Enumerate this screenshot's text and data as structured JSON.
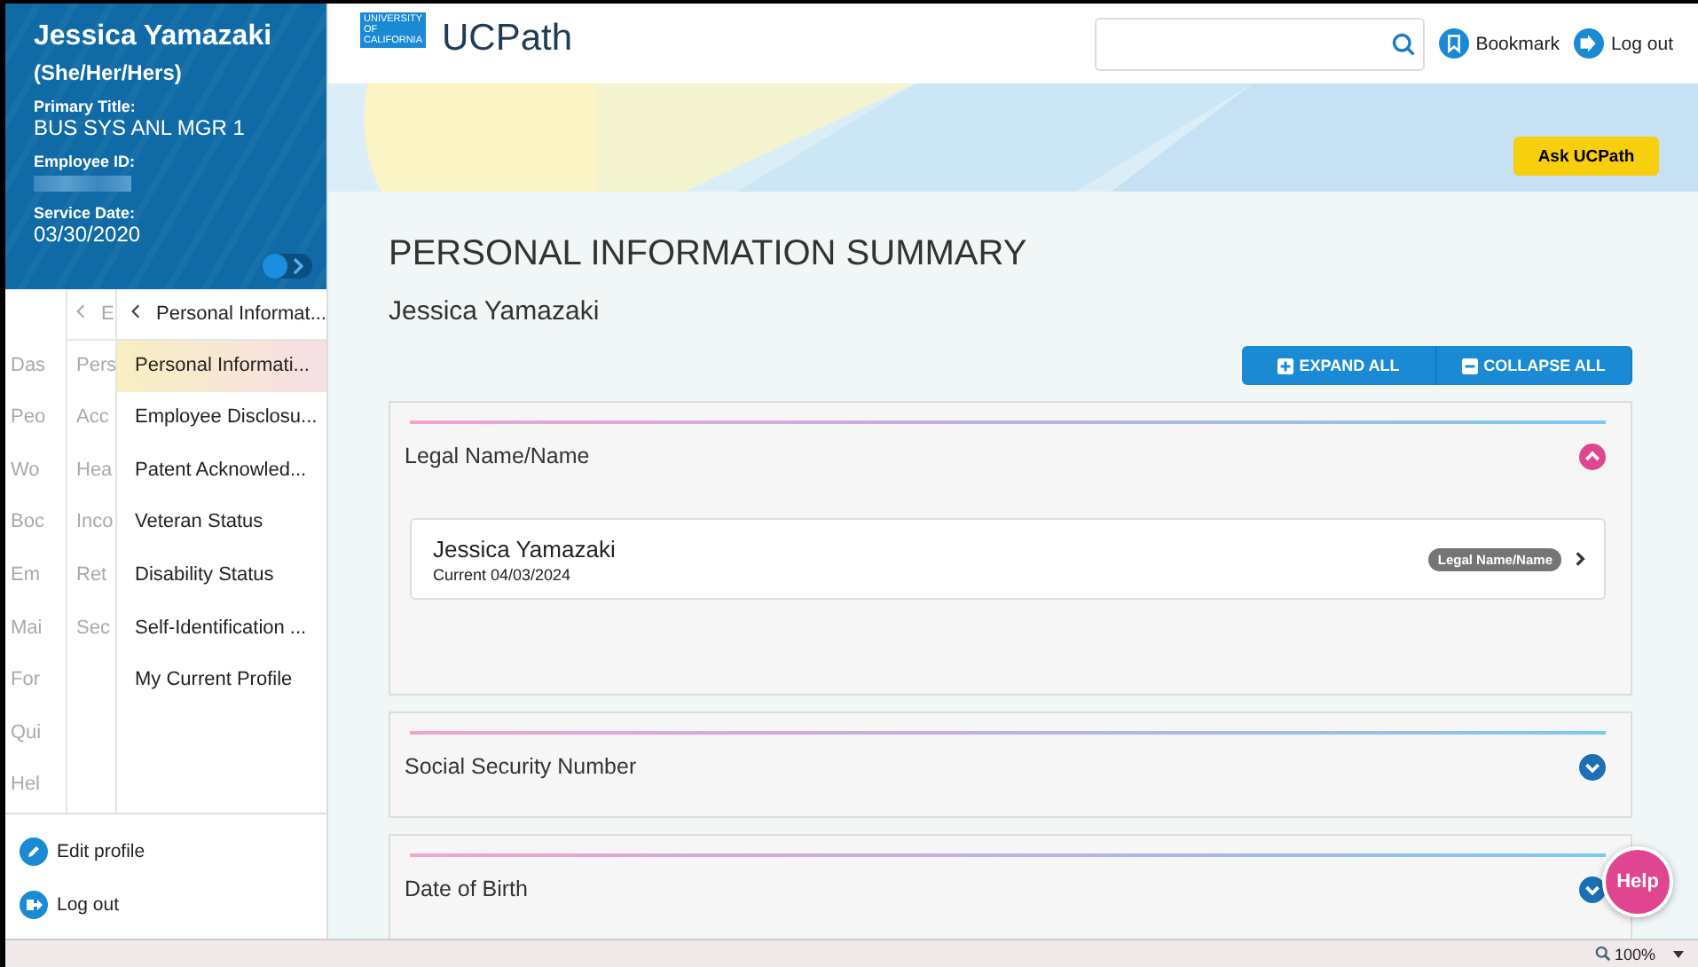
{
  "profile": {
    "name": "Jessica Yamazaki",
    "pronouns": "(She/Her/Hers)",
    "fields": [
      {
        "label": "Primary Title:",
        "value": "BUS SYS ANL MGR 1"
      },
      {
        "label": "Employee ID:"
      },
      {
        "label": "Service Date:",
        "value": "03/30/2020"
      }
    ]
  },
  "sidebar_toggle": {
    "on": false
  },
  "nav": {
    "column_1": [
      "Das",
      "Peo",
      "Wo",
      "Boc",
      "Em",
      "Mai",
      "For",
      "Qui",
      "Hel"
    ],
    "column_2": {
      "back": "E",
      "items": [
        "Pers",
        "Acc",
        "Hea",
        "Inco",
        "Ret",
        "Sec"
      ]
    },
    "column_3": {
      "back": "Personal Informat...",
      "items": [
        {
          "label": "Personal Informati...",
          "selected": true
        },
        {
          "label": "Employee Disclosu...",
          "selected": false
        },
        {
          "label": "Patent Acknowled...",
          "selected": false
        },
        {
          "label": "Veteran Status",
          "selected": false
        },
        {
          "label": "Disability Status",
          "selected": false
        },
        {
          "label": "Self-Identification ...",
          "selected": false
        },
        {
          "label": "My Current Profile",
          "selected": false
        }
      ]
    }
  },
  "sidebar_footer": [
    "Edit profile",
    "Log out"
  ],
  "header": {
    "logo_lines": [
      "UNIVERSITY",
      "OF",
      "CALIFORNIA"
    ],
    "brand": "UCPath",
    "actions": [
      "Bookmark",
      "Log out"
    ]
  },
  "ask_button": "Ask UCPath",
  "page_title": "PERSONAL INFORMATION SUMMARY",
  "person": "Jessica Yamazaki",
  "toolbar": [
    "EXPAND ALL",
    "COLLAPSE ALL"
  ],
  "sections": [
    {
      "title": "Legal Name/Name",
      "expanded": true,
      "records": [
        {
          "name": "Jessica Yamazaki",
          "detail": "Current 04/03/2024",
          "tag": "Legal Name/Name"
        }
      ]
    },
    {
      "title": "Social Security Number",
      "expanded": false
    },
    {
      "title": "Date of Birth",
      "expanded": false
    }
  ],
  "help": "Help",
  "status_bar": {
    "zoom": "100%"
  }
}
